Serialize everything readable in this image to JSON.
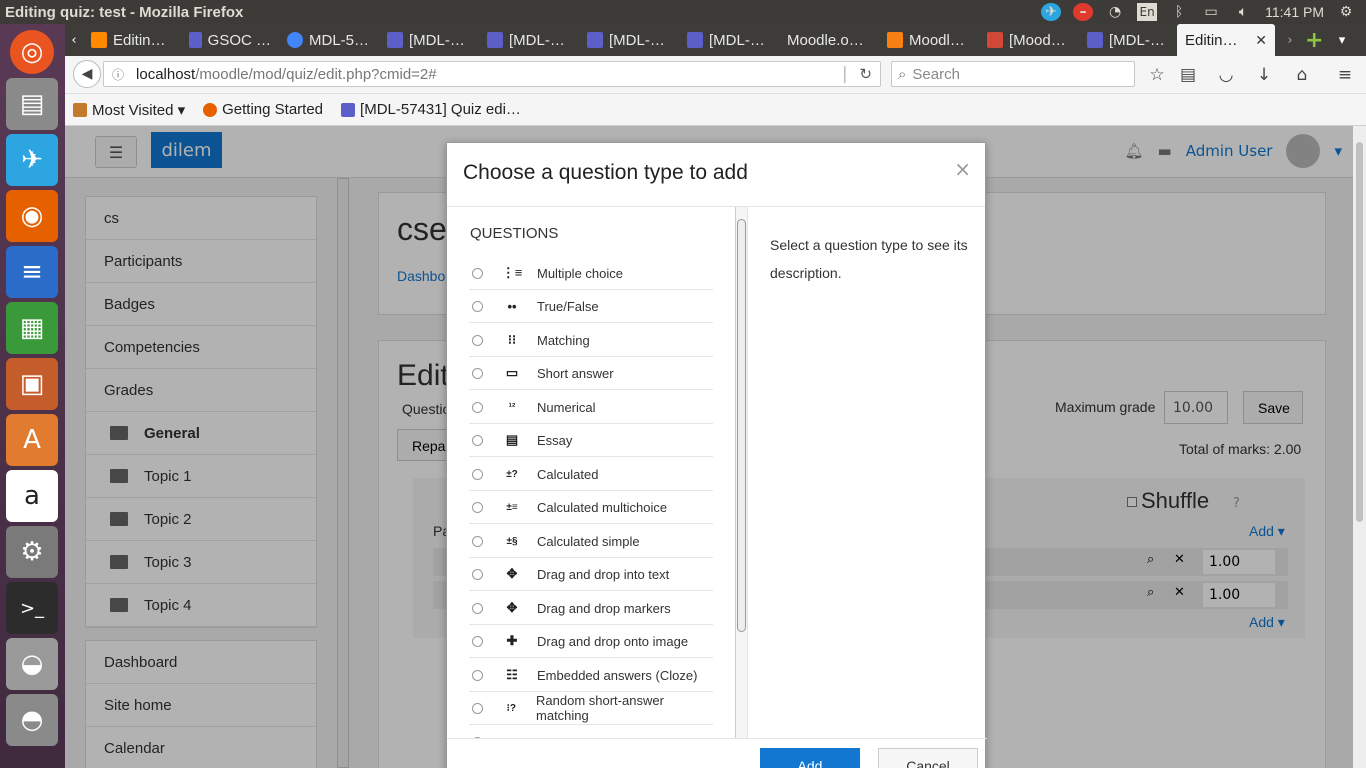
{
  "window": {
    "title": "Editing quiz: test - Mozilla Firefox",
    "keyboard_lang": "En",
    "clock": "11:41 PM"
  },
  "tabs": [
    {
      "label": "Editin…",
      "icon_color": "#ff8a00"
    },
    {
      "label": "GSOC …",
      "icon_color": "#5b5fc7"
    },
    {
      "label": "MDL-5…",
      "icon_color": "#4285f4"
    },
    {
      "label": "[MDL-…",
      "icon_color": "#5b5fc7"
    },
    {
      "label": "[MDL-…",
      "icon_color": "#5b5fc7"
    },
    {
      "label": "[MDL-…",
      "icon_color": "#5b5fc7"
    },
    {
      "label": "[MDL-…",
      "icon_color": "#5b5fc7"
    },
    {
      "label": "Moodle.o…",
      "icon_color": "#3d3c38"
    },
    {
      "label": "Moodl…",
      "icon_color": "#f98012"
    },
    {
      "label": "[Mood…",
      "icon_color": "#d14836"
    },
    {
      "label": "[MDL-…",
      "icon_color": "#5b5fc7"
    },
    {
      "label": "Editin…",
      "icon_color": "#f5f5f5",
      "active": true
    }
  ],
  "navbar": {
    "url_host": "localhost",
    "url_path": "/moodle/mod/quiz/edit.php?cmid=2#",
    "search_placeholder": "Search"
  },
  "bookmarks": [
    {
      "label": "Most Visited ▾",
      "icon_color": "#c47a2c"
    },
    {
      "label": "Getting Started",
      "icon_color": "#e66000"
    },
    {
      "label": "[MDL-57431] Quiz edi…",
      "icon_color": "#5b5fc7"
    }
  ],
  "moodle": {
    "brand": "dilem",
    "user": "Admin User",
    "sidenav_course": [
      {
        "label": "cs",
        "type": "plain"
      },
      {
        "label": "Participants",
        "type": "plain"
      },
      {
        "label": "Badges",
        "type": "plain"
      },
      {
        "label": "Competencies",
        "type": "plain"
      },
      {
        "label": "Grades",
        "type": "plain"
      },
      {
        "label": "General",
        "type": "folder",
        "bold": true
      },
      {
        "label": "Topic 1",
        "type": "folder"
      },
      {
        "label": "Topic 2",
        "type": "folder"
      },
      {
        "label": "Topic 3",
        "type": "folder"
      },
      {
        "label": "Topic 4",
        "type": "folder"
      }
    ],
    "sidenav_site": [
      "Dashboard",
      "Site home",
      "Calendar"
    ],
    "course_heading": "cse",
    "breadcrumb_start": "Dashbo",
    "edit_heading": "Edit",
    "questions_label": "Questio",
    "repaginate_label": "Repa",
    "maximum_grade_label": "Maximum grade",
    "maximum_grade_value": "10.00",
    "save_label": "Save",
    "total_marks": "Total of marks: 2.00",
    "shuffle_label": "Shuffle",
    "page_label": "Pa",
    "add_label": "Add ▾",
    "slot_marks": [
      "1.00",
      "1.00"
    ]
  },
  "modal": {
    "title": "Choose a question type to add",
    "section_heading": "QUESTIONS",
    "question_types": [
      {
        "label": "Multiple choice",
        "icon": "list-icon"
      },
      {
        "label": "True/False",
        "icon": "dots-icon"
      },
      {
        "label": "Matching",
        "icon": "matching-icon"
      },
      {
        "label": "Short answer",
        "icon": "textbox-icon"
      },
      {
        "label": "Numerical",
        "icon": "numerical-icon"
      },
      {
        "label": "Essay",
        "icon": "essay-icon"
      },
      {
        "label": "Calculated",
        "icon": "calculated-icon"
      },
      {
        "label": "Calculated multichoice",
        "icon": "calculated-multichoice-icon"
      },
      {
        "label": "Calculated simple",
        "icon": "calculated-simple-icon"
      },
      {
        "label": "Drag and drop into text",
        "icon": "move-icon"
      },
      {
        "label": "Drag and drop markers",
        "icon": "move-icon"
      },
      {
        "label": "Drag and drop onto image",
        "icon": "plus-move-icon"
      },
      {
        "label": "Embedded answers (Cloze)",
        "icon": "cloze-icon"
      },
      {
        "label": "Random short-answer matching",
        "icon": "random-matching-icon"
      }
    ],
    "description": "Select a question type to see its description.",
    "add_button": "Add",
    "cancel_button": "Cancel"
  }
}
